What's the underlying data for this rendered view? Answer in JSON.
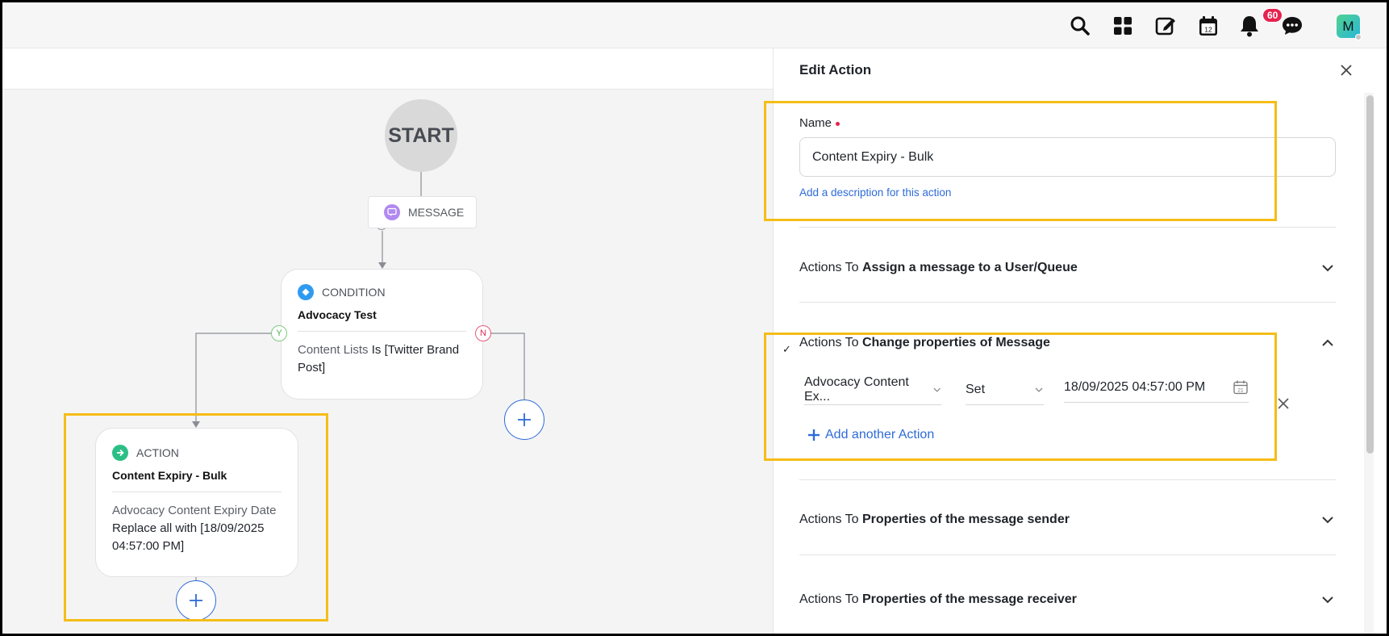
{
  "topbar": {
    "icons": [
      "search-icon",
      "grid-icon",
      "compose-icon",
      "calendar-icon",
      "bell-icon",
      "chat-icon"
    ],
    "calendar_day": "12",
    "notification_count": "60",
    "avatar_initial": "M"
  },
  "flow": {
    "start_label": "START",
    "message_label": "MESSAGE",
    "condition": {
      "type_label": "CONDITION",
      "title": "Advocacy Test",
      "field": "Content Lists",
      "operator": " Is ",
      "value": "[Twitter Brand Post]"
    },
    "yes_label": "Y",
    "no_label": "N",
    "action": {
      "type_label": "ACTION",
      "title": "Content Expiry - Bulk",
      "field": "Advocacy Content Expiry Date",
      "operation": " Replace all with ",
      "value": "[18/09/2025 04:57:00 PM]"
    }
  },
  "panel": {
    "title": "Edit Action",
    "name_label": "Name",
    "name_value": "Content Expiry - Bulk",
    "description_link": "Add a description for this action",
    "sections": [
      {
        "prefix": "Actions To ",
        "label": "Assign a message to a User/Queue",
        "expanded": false
      },
      {
        "prefix": "Actions To ",
        "label": "Change properties of Message",
        "expanded": true
      },
      {
        "prefix": "Actions To ",
        "label": "Properties of the message sender",
        "expanded": false
      },
      {
        "prefix": "Actions To ",
        "label": "Properties of the message receiver",
        "expanded": false
      }
    ],
    "checkmark": "✓",
    "property_field": "Advocacy Content Ex...",
    "operation": "Set",
    "date_value": "18/09/2025 04:57:00 PM",
    "calendar_day": "21",
    "add_action_label": "Add another Action"
  },
  "colors": {
    "highlight": "#f5bd16",
    "link": "#2e6bd8",
    "badge": "#e5224f",
    "condition_icon": "#2f9bf0",
    "action_icon": "#2bbf85",
    "message_icon": "#b189f0"
  }
}
